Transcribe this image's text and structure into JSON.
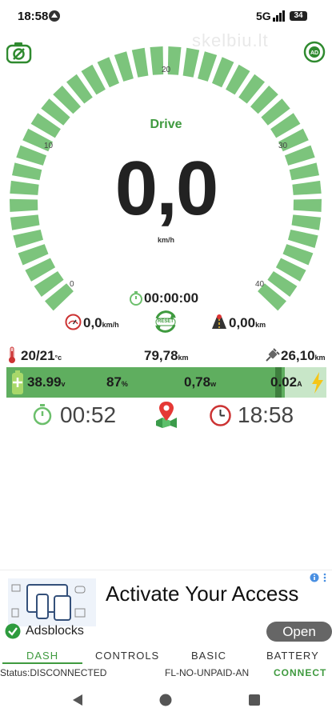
{
  "status_bar": {
    "time": "18:58",
    "network": "5G",
    "battery": "34"
  },
  "watermark": "skelbiu.lt",
  "gauge": {
    "mode": "Drive",
    "speed": "0,0",
    "unit": "km/h",
    "ticks": [
      "0",
      "10",
      "20",
      "30",
      "40"
    ],
    "color": "#7cc47c"
  },
  "trip": {
    "timer": "00:00:00",
    "avg_speed": "0,0",
    "avg_speed_unit": "km/h",
    "trip_distance": "0,00",
    "trip_distance_unit": "km",
    "reset_label": "RESET"
  },
  "stats": {
    "temperature": "20/21",
    "temperature_unit": "°c",
    "odometer": "79,78",
    "odometer_unit": "km",
    "range": "26,10",
    "range_unit": "km"
  },
  "battery": {
    "voltage": "38.99",
    "voltage_unit": "v",
    "percent": "87",
    "percent_unit": "%",
    "power": "0,78",
    "power_unit": "w",
    "current": "0.02",
    "current_unit": "A",
    "level": 0.87
  },
  "times": {
    "ride_time": "00:52",
    "clock": "18:58"
  },
  "ad": {
    "title": "Activate Your Access",
    "sponsor": "Adsblocks",
    "open_label": "Open",
    "info_icon": "info-icon"
  },
  "tabs": [
    {
      "label": "DASH",
      "active": true
    },
    {
      "label": "CONTROLS",
      "active": false
    },
    {
      "label": "BASIC",
      "active": false
    },
    {
      "label": "BATTERY",
      "active": false
    }
  ],
  "status_line": {
    "status": "Status:DISCONNECTED",
    "device": "FL-NO-UNPAID-AN",
    "connect": "CONNECT"
  },
  "colors": {
    "accent": "#3f9a3f",
    "battery_bar": "#5fae5f",
    "gauge_segment": "#7cc47c"
  }
}
